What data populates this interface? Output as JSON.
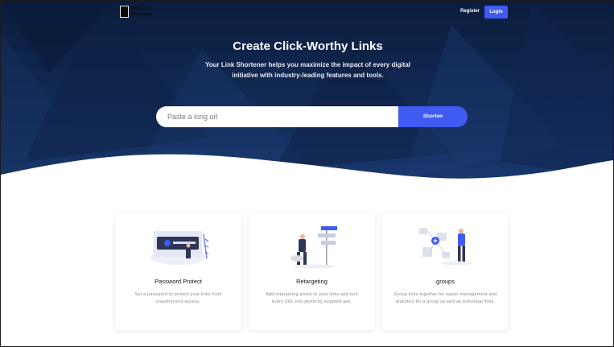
{
  "nav": {
    "logo_text": "Web Link Shortener",
    "register_label": "Register",
    "login_label": "Login"
  },
  "hero": {
    "title": "Create Click-Worthy Links",
    "subtitle": "Your Link Shortener helps you maximize the impact of every digital initiative with industry-leading features and tools."
  },
  "search": {
    "placeholder": "Paste a long url",
    "button_label": "Shorten"
  },
  "features": [
    {
      "title": "Password Protect",
      "description": "Set a password to protect your links from unauthorized access.",
      "illustration": "password-illustration"
    },
    {
      "title": "Retargeting",
      "description": "Add retargeting pixels to your links and turn every URL into perfectly targeted ads.",
      "illustration": "retargeting-illustration"
    },
    {
      "title": "groups",
      "description": "Group links together for easier management and analytics for a group as well as individual links.",
      "illustration": "groups-illustration"
    }
  ],
  "colors": {
    "accent": "#3f5bf1",
    "hero_dark": "#0b1d3e",
    "hero_light": "#1a3a72"
  }
}
